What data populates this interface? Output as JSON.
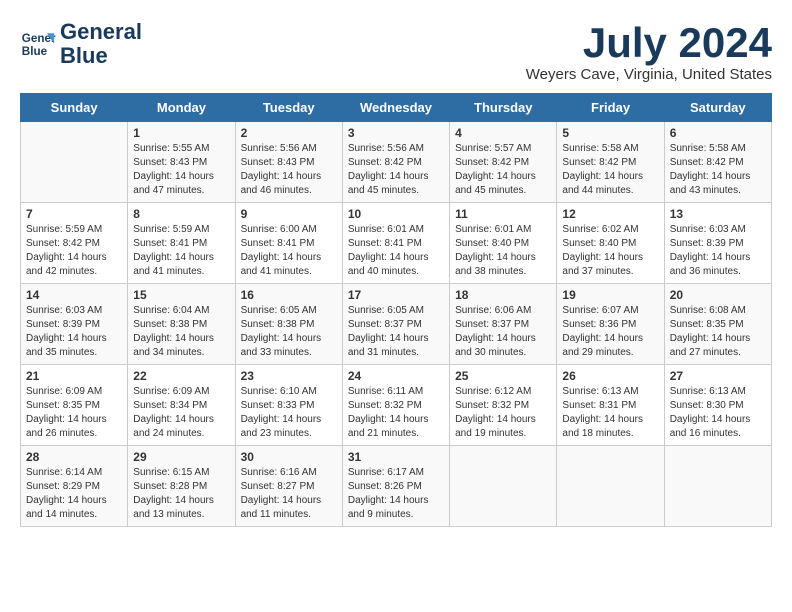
{
  "header": {
    "logo_line1": "General",
    "logo_line2": "Blue",
    "month": "July 2024",
    "location": "Weyers Cave, Virginia, United States"
  },
  "weekdays": [
    "Sunday",
    "Monday",
    "Tuesday",
    "Wednesday",
    "Thursday",
    "Friday",
    "Saturday"
  ],
  "weeks": [
    [
      {
        "day": "",
        "info": ""
      },
      {
        "day": "1",
        "info": "Sunrise: 5:55 AM\nSunset: 8:43 PM\nDaylight: 14 hours\nand 47 minutes."
      },
      {
        "day": "2",
        "info": "Sunrise: 5:56 AM\nSunset: 8:43 PM\nDaylight: 14 hours\nand 46 minutes."
      },
      {
        "day": "3",
        "info": "Sunrise: 5:56 AM\nSunset: 8:42 PM\nDaylight: 14 hours\nand 45 minutes."
      },
      {
        "day": "4",
        "info": "Sunrise: 5:57 AM\nSunset: 8:42 PM\nDaylight: 14 hours\nand 45 minutes."
      },
      {
        "day": "5",
        "info": "Sunrise: 5:58 AM\nSunset: 8:42 PM\nDaylight: 14 hours\nand 44 minutes."
      },
      {
        "day": "6",
        "info": "Sunrise: 5:58 AM\nSunset: 8:42 PM\nDaylight: 14 hours\nand 43 minutes."
      }
    ],
    [
      {
        "day": "7",
        "info": "Sunrise: 5:59 AM\nSunset: 8:42 PM\nDaylight: 14 hours\nand 42 minutes."
      },
      {
        "day": "8",
        "info": "Sunrise: 5:59 AM\nSunset: 8:41 PM\nDaylight: 14 hours\nand 41 minutes."
      },
      {
        "day": "9",
        "info": "Sunrise: 6:00 AM\nSunset: 8:41 PM\nDaylight: 14 hours\nand 41 minutes."
      },
      {
        "day": "10",
        "info": "Sunrise: 6:01 AM\nSunset: 8:41 PM\nDaylight: 14 hours\nand 40 minutes."
      },
      {
        "day": "11",
        "info": "Sunrise: 6:01 AM\nSunset: 8:40 PM\nDaylight: 14 hours\nand 38 minutes."
      },
      {
        "day": "12",
        "info": "Sunrise: 6:02 AM\nSunset: 8:40 PM\nDaylight: 14 hours\nand 37 minutes."
      },
      {
        "day": "13",
        "info": "Sunrise: 6:03 AM\nSunset: 8:39 PM\nDaylight: 14 hours\nand 36 minutes."
      }
    ],
    [
      {
        "day": "14",
        "info": "Sunrise: 6:03 AM\nSunset: 8:39 PM\nDaylight: 14 hours\nand 35 minutes."
      },
      {
        "day": "15",
        "info": "Sunrise: 6:04 AM\nSunset: 8:38 PM\nDaylight: 14 hours\nand 34 minutes."
      },
      {
        "day": "16",
        "info": "Sunrise: 6:05 AM\nSunset: 8:38 PM\nDaylight: 14 hours\nand 33 minutes."
      },
      {
        "day": "17",
        "info": "Sunrise: 6:05 AM\nSunset: 8:37 PM\nDaylight: 14 hours\nand 31 minutes."
      },
      {
        "day": "18",
        "info": "Sunrise: 6:06 AM\nSunset: 8:37 PM\nDaylight: 14 hours\nand 30 minutes."
      },
      {
        "day": "19",
        "info": "Sunrise: 6:07 AM\nSunset: 8:36 PM\nDaylight: 14 hours\nand 29 minutes."
      },
      {
        "day": "20",
        "info": "Sunrise: 6:08 AM\nSunset: 8:35 PM\nDaylight: 14 hours\nand 27 minutes."
      }
    ],
    [
      {
        "day": "21",
        "info": "Sunrise: 6:09 AM\nSunset: 8:35 PM\nDaylight: 14 hours\nand 26 minutes."
      },
      {
        "day": "22",
        "info": "Sunrise: 6:09 AM\nSunset: 8:34 PM\nDaylight: 14 hours\nand 24 minutes."
      },
      {
        "day": "23",
        "info": "Sunrise: 6:10 AM\nSunset: 8:33 PM\nDaylight: 14 hours\nand 23 minutes."
      },
      {
        "day": "24",
        "info": "Sunrise: 6:11 AM\nSunset: 8:32 PM\nDaylight: 14 hours\nand 21 minutes."
      },
      {
        "day": "25",
        "info": "Sunrise: 6:12 AM\nSunset: 8:32 PM\nDaylight: 14 hours\nand 19 minutes."
      },
      {
        "day": "26",
        "info": "Sunrise: 6:13 AM\nSunset: 8:31 PM\nDaylight: 14 hours\nand 18 minutes."
      },
      {
        "day": "27",
        "info": "Sunrise: 6:13 AM\nSunset: 8:30 PM\nDaylight: 14 hours\nand 16 minutes."
      }
    ],
    [
      {
        "day": "28",
        "info": "Sunrise: 6:14 AM\nSunset: 8:29 PM\nDaylight: 14 hours\nand 14 minutes."
      },
      {
        "day": "29",
        "info": "Sunrise: 6:15 AM\nSunset: 8:28 PM\nDaylight: 14 hours\nand 13 minutes."
      },
      {
        "day": "30",
        "info": "Sunrise: 6:16 AM\nSunset: 8:27 PM\nDaylight: 14 hours\nand 11 minutes."
      },
      {
        "day": "31",
        "info": "Sunrise: 6:17 AM\nSunset: 8:26 PM\nDaylight: 14 hours\nand 9 minutes."
      },
      {
        "day": "",
        "info": ""
      },
      {
        "day": "",
        "info": ""
      },
      {
        "day": "",
        "info": ""
      }
    ]
  ]
}
